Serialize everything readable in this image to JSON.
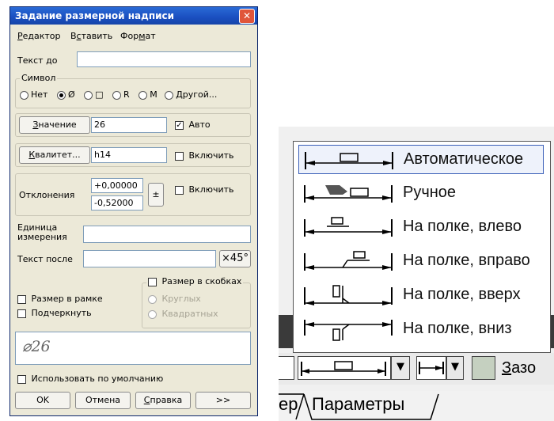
{
  "dialog": {
    "title": "Задание размерной надписи",
    "close_glyph": "✕",
    "menu": [
      {
        "pre": "",
        "u": "Р",
        "post": "едактор"
      },
      {
        "pre": "В",
        "u": "с",
        "post": "тавить"
      },
      {
        "pre": "Фор",
        "u": "м",
        "post": "ат"
      }
    ],
    "text_before_label": "Текст до",
    "text_before_value": "",
    "symbol": {
      "legend": "Символ",
      "options": [
        "Нет",
        "Ø",
        "□",
        "R",
        "M",
        "Другой..."
      ],
      "selected": 1
    },
    "value": {
      "button_u": "З",
      "button_rest": "начение",
      "field": "26",
      "auto_label": "Авто",
      "auto_checked": true
    },
    "qualitet": {
      "button_u": "К",
      "button_rest": "валитет...",
      "field": "h14",
      "enable_label": "Включить"
    },
    "deviations": {
      "label": "Отклонения",
      "upper": "+0,00000",
      "lower": "-0,52000",
      "pm": "±",
      "enable_label": "Включить"
    },
    "unit": {
      "label_line1": "Единица",
      "label_line2": "измерения",
      "value": ""
    },
    "text_after": {
      "label": "Текст после",
      "value": "",
      "angle_button": "×45°"
    },
    "brackets": {
      "label": "Размер в скобках",
      "opt1": "Круглых",
      "opt2": "Квадратных"
    },
    "frame_label": "Размер в рамке",
    "underline_label": "Подчеркнуть",
    "preview": "⌀26",
    "default_label": "Использовать по умолчанию",
    "buttons": {
      "ok": "OK",
      "cancel": "Отмена",
      "help_u": "С",
      "help_rest": "правка",
      "more": ">>"
    }
  },
  "placement_menu": {
    "options": [
      {
        "label": "Автоматическое",
        "icon": "auto-placement-icon"
      },
      {
        "label": "Ручное",
        "icon": "manual-placement-icon"
      },
      {
        "label": "На полке, влево",
        "icon": "shelf-left-icon"
      },
      {
        "label": "На полке, вправо",
        "icon": "shelf-right-icon"
      },
      {
        "label": "На полке, вверх",
        "icon": "shelf-up-icon"
      },
      {
        "label": "На полке, вниз",
        "icon": "shelf-down-icon"
      }
    ],
    "selected": 0
  },
  "toolbar": {
    "gap_label_u": "З",
    "gap_label_rest": "азо"
  },
  "tabs": {
    "partial_left": "ер",
    "active": "Параметры"
  }
}
